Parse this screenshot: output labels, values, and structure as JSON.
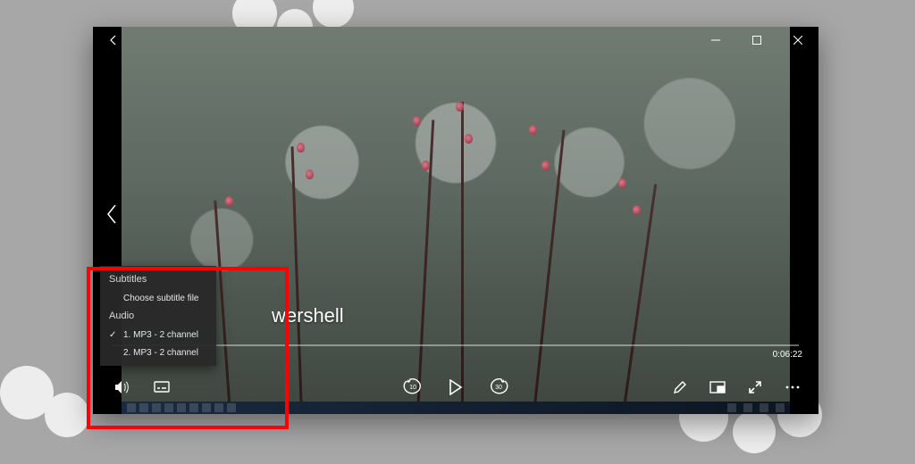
{
  "titlebar": {
    "back_tooltip": "Back",
    "minimize_tooltip": "Minimize",
    "maximize_tooltip": "Maximize",
    "close_tooltip": "Close"
  },
  "video": {
    "title_visible_fragment": "wershell",
    "duration": "0:06:22"
  },
  "popup": {
    "subtitles_header": "Subtitles",
    "choose_subtitle_label": "Choose subtitle file",
    "audio_header": "Audio",
    "audio_tracks": [
      {
        "label": "1. MP3 - 2 channel",
        "selected": true
      },
      {
        "label": "2. MP3 - 2 channel",
        "selected": false
      }
    ]
  },
  "controls": {
    "volume_tooltip": "Volume",
    "subtitles_audio_tooltip": "Subtitles and audio",
    "skip_back_tooltip": "Skip back 10 seconds",
    "play_tooltip": "Play",
    "skip_fwd_tooltip": "Skip forward 30 seconds",
    "edit_tooltip": "Edit",
    "miniview_tooltip": "Play in mini view",
    "fullscreen_tooltip": "Full screen",
    "more_tooltip": "More options",
    "skip_back_label": "10",
    "skip_fwd_label": "30"
  },
  "colors": {
    "highlight": "#ff0000",
    "window_bg": "#000000",
    "popup_bg": "rgba(40,40,40,0.95)"
  }
}
